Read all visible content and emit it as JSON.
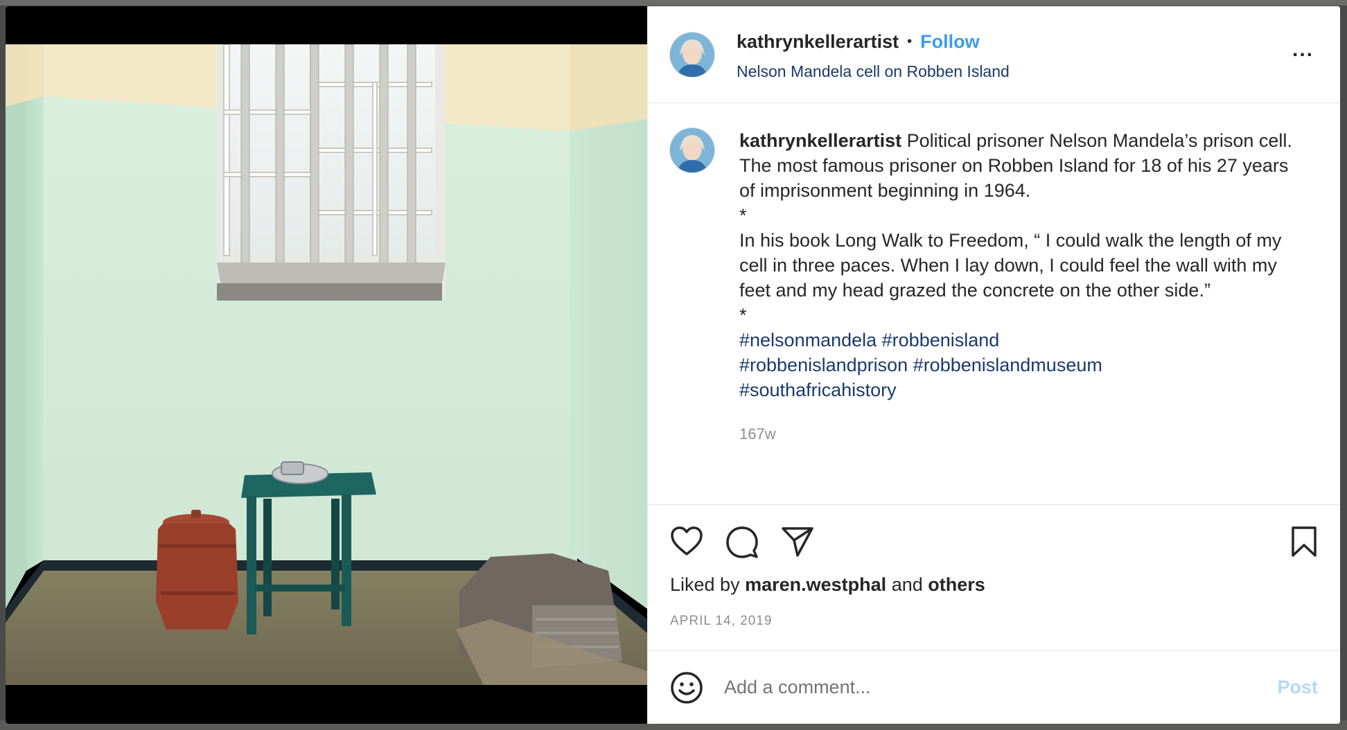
{
  "post": {
    "author": "kathrynkellerartist",
    "separator": "•",
    "follow_label": "Follow",
    "location": "Nelson Mandela cell on Robben Island",
    "more_label": "...",
    "caption_lines": [
      "Political prisoner Nelson Mandela’s prison cell. The most famous prisoner on Robben Island for 18 of his 27 years of imprisonment beginning in 1964."
    ],
    "caption_star1": "*",
    "caption_quote": "In his book Long Walk to Freedom, “ I could walk the length of my cell in three paces. When I lay down, I could feel the wall with my feet and my head grazed the concrete on the other side.”",
    "caption_star2": "*",
    "hashtags": [
      "#nelsonmandela #robbenisland",
      "#robbenislandprison #robbenislandmuseum",
      "#southafricahistory"
    ],
    "time_ago": "167w",
    "liked_by_prefix": "Liked by",
    "liked_by_user": "maren.westphal",
    "liked_by_middle": "and",
    "liked_by_others": "others",
    "date": "APRIL 14, 2019"
  },
  "comment": {
    "placeholder": "Add a comment...",
    "post_label": "Post"
  },
  "icons": {
    "like": "heart-icon",
    "comment": "comment-icon",
    "share": "share-icon",
    "save": "bookmark-icon",
    "emoji": "emoji-icon"
  }
}
